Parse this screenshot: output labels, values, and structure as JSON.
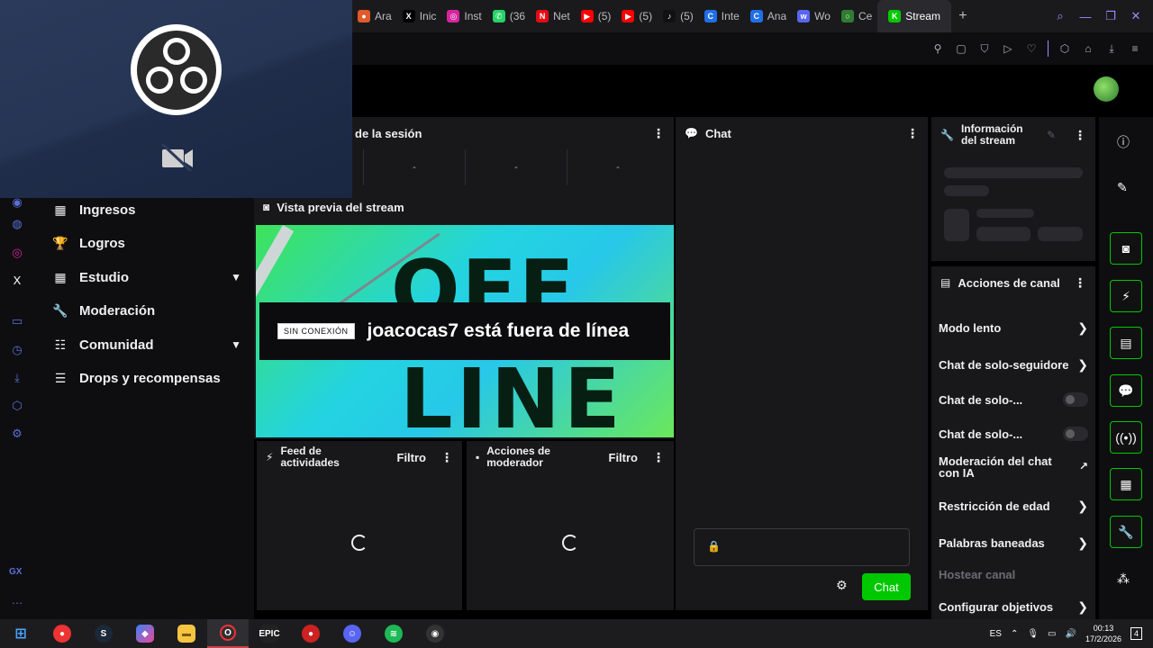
{
  "browser": {
    "tabs": [
      {
        "label": "Ara",
        "fav_color": "#e05a2b",
        "fav_glyph": "●"
      },
      {
        "label": "Inic",
        "fav_color": "#000000",
        "fav_glyph": "X"
      },
      {
        "label": "Inst",
        "fav_color": "#d6249f",
        "fav_glyph": "◎"
      },
      {
        "label": "(36",
        "fav_color": "#25d366",
        "fav_glyph": "✆"
      },
      {
        "label": "Net",
        "fav_color": "#e50914",
        "fav_glyph": "N"
      },
      {
        "label": "(5)",
        "fav_color": "#ff0000",
        "fav_glyph": "▶"
      },
      {
        "label": "(5)",
        "fav_color": "#ff0000",
        "fav_glyph": "▶"
      },
      {
        "label": "(5)",
        "fav_color": "#111111",
        "fav_glyph": "♪"
      },
      {
        "label": "Inte",
        "fav_color": "#1f6feb",
        "fav_glyph": "C"
      },
      {
        "label": "Ana",
        "fav_color": "#1f6feb",
        "fav_glyph": "C"
      },
      {
        "label": "Wo",
        "fav_color": "#5865f2",
        "fav_glyph": "w"
      },
      {
        "label": "Ce",
        "fav_color": "#2e7d32",
        "fav_glyph": "○"
      },
      {
        "label": "Stream",
        "fav_color": "#00c800",
        "fav_glyph": "K",
        "active": true
      }
    ],
    "new_tab": "+"
  },
  "sidebar_nav": {
    "items": [
      {
        "label": "Ingresos",
        "icon": "bar-chart-icon"
      },
      {
        "label": "Logros",
        "icon": "trophy-icon"
      },
      {
        "label": "Estudio",
        "icon": "studio-icon",
        "expandable": true
      },
      {
        "label": "Moderación",
        "icon": "wrench-icon"
      },
      {
        "label": "Comunidad",
        "icon": "community-icon",
        "expandable": true
      },
      {
        "label": "Drops y recompensas",
        "icon": "drops-icon"
      }
    ],
    "rail_label": "GX"
  },
  "session": {
    "title": "de la sesión",
    "stats": [
      "-",
      "-",
      "-"
    ]
  },
  "preview": {
    "title": "Vista previa del stream",
    "badge": "SIN CONEXIÓN",
    "message": "joacocas7 está fuera de línea",
    "image_text_1": "OFF",
    "image_text_2": "LINE"
  },
  "feed": {
    "title_line1": "Feed de",
    "title_line2": "actividades",
    "filter": "Filtro"
  },
  "mod_actions": {
    "title_line1": "Acciones de",
    "title_line2": "moderador",
    "filter": "Filtro"
  },
  "chat": {
    "title": "Chat",
    "button": "Chat"
  },
  "stream_info": {
    "title_line1": "Información",
    "title_line2": "del stream"
  },
  "channel_actions": {
    "title": "Acciones de canal",
    "items": [
      {
        "label": "Modo lento",
        "control": "arrow"
      },
      {
        "label": "Chat de solo-seguidores",
        "control": "arrow"
      },
      {
        "label": "Chat de solo-...",
        "control": "toggle"
      },
      {
        "label": "Chat de solo-...",
        "control": "toggle"
      },
      {
        "label": "Moderación del chat con IA",
        "control": "external"
      },
      {
        "label": "Restricción de edad",
        "control": "arrow"
      },
      {
        "label": "Palabras baneadas",
        "control": "arrow"
      },
      {
        "label": "Hostear canal",
        "control": "none",
        "disabled": true
      },
      {
        "label": "Configurar objetivos",
        "control": "arrow"
      }
    ]
  },
  "taskbar": {
    "language": "ES",
    "time": "00:13",
    "date": "17/2/2026",
    "notifications": "4"
  },
  "colors": {
    "accent": "#00c800",
    "panel": "#18181b",
    "background": "#0e0e10"
  }
}
